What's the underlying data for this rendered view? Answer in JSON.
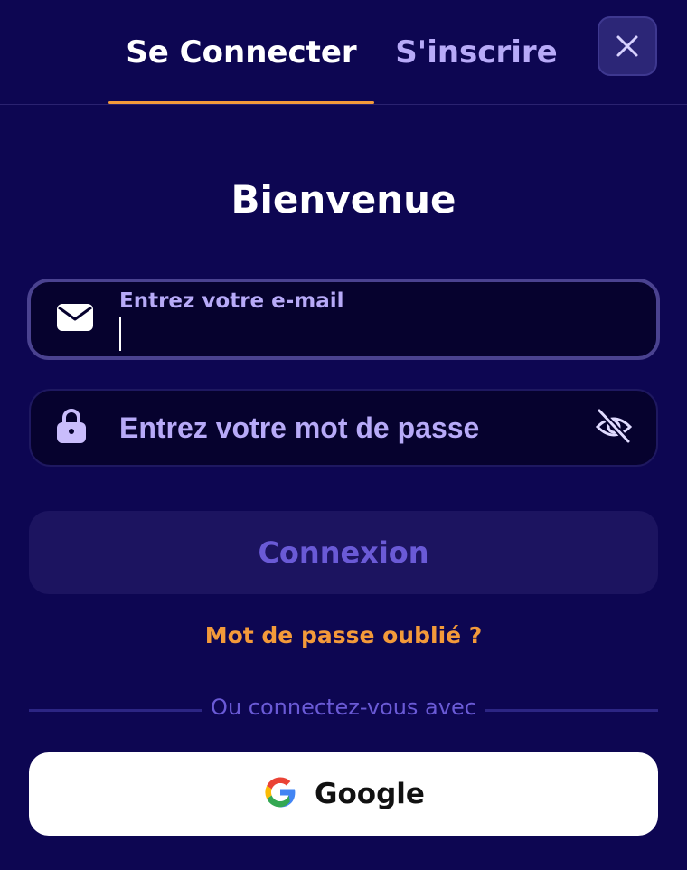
{
  "tabs": {
    "login": "Se Connecter",
    "signup": "S'inscrire"
  },
  "header": {
    "close_icon": "close-icon"
  },
  "title": "Bienvenue",
  "email_field": {
    "label": "Entrez votre e-mail",
    "value": "",
    "icon": "envelope-icon"
  },
  "password_field": {
    "placeholder": "Entrez votre mot de passe",
    "value": "",
    "icon": "lock-icon",
    "toggle_icon": "eye-slash-icon"
  },
  "connect_button": "Connexion",
  "forgot_password": "Mot de passe oublié ?",
  "divider_text": "Ou connectez-vous avec",
  "google_button": {
    "label": "Google",
    "icon": "google-icon"
  },
  "colors": {
    "background": "#0d0652",
    "accent": "#f39a3a",
    "tab_inactive": "#b7aaf8",
    "button_disabled": "#1c1460"
  }
}
